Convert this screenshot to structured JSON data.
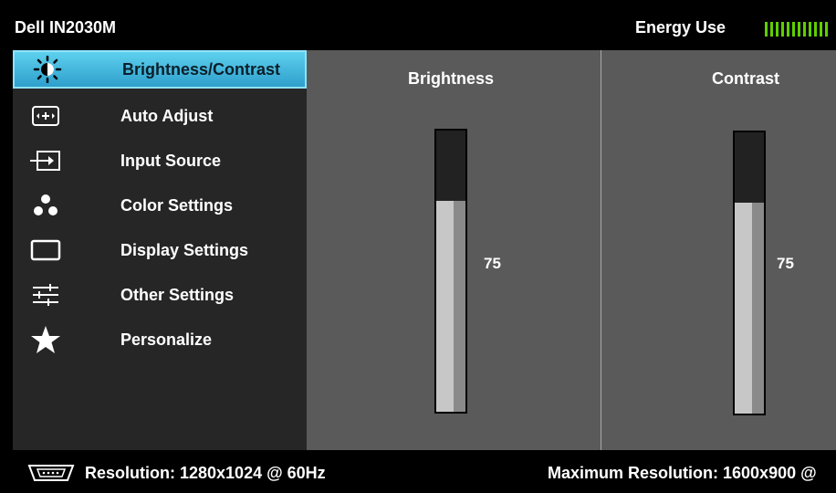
{
  "header": {
    "title": "Dell IN2030M",
    "energy_label": "Energy Use",
    "energy_color": "#5fcf00"
  },
  "menu": {
    "items": [
      {
        "label": "Brightness/Contrast",
        "icon": "sun-icon",
        "selected": true
      },
      {
        "label": "Auto Adjust",
        "icon": "auto-adjust-icon"
      },
      {
        "label": "Input Source",
        "icon": "input-source-icon"
      },
      {
        "label": "Color Settings",
        "icon": "color-dots-icon"
      },
      {
        "label": "Display Settings",
        "icon": "display-rectangle-icon"
      },
      {
        "label": "Other Settings",
        "icon": "sliders-icon"
      },
      {
        "label": "Personalize",
        "icon": "star-icon"
      }
    ]
  },
  "brightness": {
    "title": "Brightness",
    "value": "75",
    "level": 0.75
  },
  "contrast": {
    "title": "Contrast",
    "value": "75",
    "level": 0.75
  },
  "footer": {
    "resolution": "Resolution: 1280x1024 @ 60Hz",
    "max_resolution": "Maximum Resolution: 1600x900 @"
  },
  "colors": {
    "selected": "#3fb6e0",
    "panel": "#5a5a5a",
    "sidebar": "#262626"
  }
}
